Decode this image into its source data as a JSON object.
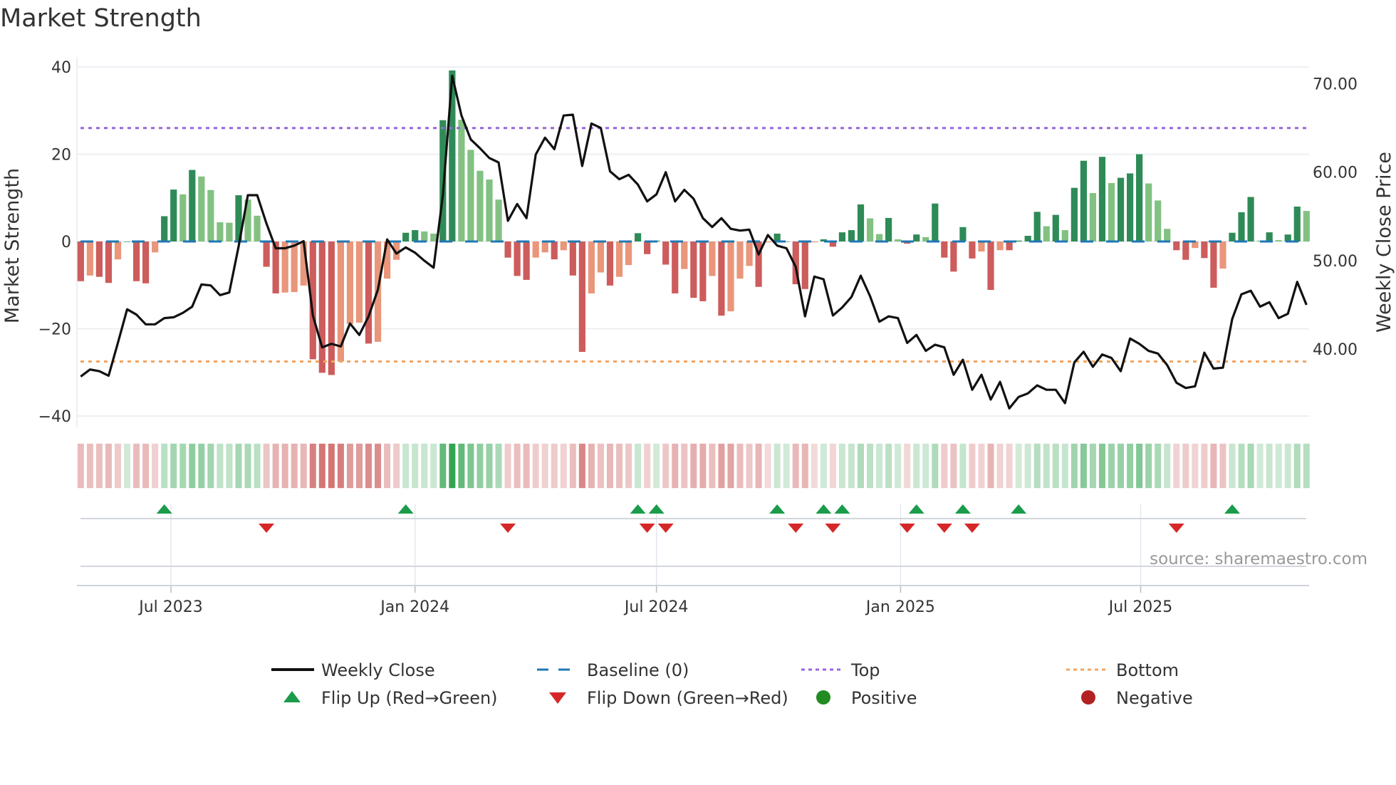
{
  "title": "Market Strength",
  "source": "source: sharemaestro.com",
  "colors": {
    "pos_strong": "#2e8b57",
    "pos_weak": "#82c182",
    "neg_strong": "#cd5c5c",
    "neg_weak": "#e9967a",
    "baseline": "#1f77b4",
    "top": "#9966dd",
    "bottom": "#f4a460",
    "close": "#111111",
    "flip_up": "#1a9c4a",
    "flip_down": "#d62728",
    "positive": "#228b22",
    "negative": "#b22222"
  },
  "chart_data": {
    "type": "bar",
    "title": "Market Strength",
    "ylabel": "Market Strength",
    "y2label": "Weekly Close Price",
    "ylim": [
      -42,
      42
    ],
    "y2lim": [
      32.4,
      71.8
    ],
    "yticks": [
      "40",
      "20",
      "0",
      "−20",
      "−40"
    ],
    "ytick_values": [
      40,
      20,
      0,
      -20,
      -40
    ],
    "y2ticks": [
      "70.00",
      "60.00",
      "50.00",
      "40.00"
    ],
    "y2tick_values": [
      70,
      60,
      50,
      40
    ],
    "xticks": [
      {
        "label": "Jul 2023",
        "date": "2023-07-01"
      },
      {
        "label": "Jan 2024",
        "date": "2024-01-01"
      },
      {
        "label": "Jul 2024",
        "date": "2024-07-01"
      },
      {
        "label": "Jan 2025",
        "date": "2025-01-01"
      },
      {
        "label": "Jul 2025",
        "date": "2025-07-01"
      }
    ],
    "start_date": "2023-04-24",
    "interval_days": 7,
    "levels": {
      "baseline": 0,
      "top": 26,
      "bottom": -27.5
    },
    "strength": [
      -9.1,
      -7.8,
      -8.1,
      -9.5,
      -4.1,
      0,
      -9.1,
      -9.6,
      -2.5,
      5.8,
      11.9,
      10.8,
      16.4,
      14.9,
      11.8,
      4.4,
      4.3,
      10.6,
      9.6,
      5.9,
      -5.8,
      -11.9,
      -11.7,
      -11.6,
      -10.1,
      -27,
      -30.1,
      -30.6,
      -27.5,
      -18.9,
      -18.6,
      -23.4,
      -23,
      -8.5,
      -4.2,
      2,
      2.6,
      2.3,
      1.8,
      27.8,
      39.2,
      27.9,
      21,
      16.2,
      14.2,
      9.6,
      -3.7,
      -7.9,
      -8.8,
      -3.7,
      -2.5,
      -4.1,
      -2,
      -7.8,
      -25.3,
      -11.9,
      -7.1,
      -10.1,
      -8.1,
      -5.4,
      1.9,
      -2.9,
      0.2,
      -5.3,
      -11.9,
      -6.3,
      -12.9,
      -13.7,
      -7.9,
      -17,
      -16,
      -8.5,
      -5.6,
      -10.4,
      -0.2,
      1.8,
      0,
      -9.8,
      -10.9,
      -0.2,
      0.5,
      -1.2,
      2.1,
      2.6,
      8.5,
      5.3,
      1.7,
      5.4,
      0.5,
      -0.5,
      1.6,
      1.0,
      8.7,
      -3.7,
      -6.9,
      3.3,
      -3.9,
      -2.3,
      -11.1,
      -2.0,
      -2.0,
      0.2,
      1.3,
      6.8,
      3.5,
      6.1,
      2.6,
      12.3,
      18.5,
      11.1,
      19.4,
      13.4,
      14.6,
      15.6,
      20.0,
      13.3,
      9.4,
      2.9,
      -2.0,
      -4.2,
      -1.5,
      -3.8,
      -10.6,
      -6.2,
      2.0,
      6.7,
      10.2,
      0.2,
      2.1,
      0.3,
      1.6,
      8.0,
      7.0
    ],
    "weekly_close": [
      36.9,
      37.7,
      37.5,
      37.0,
      40.7,
      44.5,
      43.9,
      42.8,
      42.8,
      43.5,
      43.6,
      44.1,
      44.8,
      47.3,
      47.2,
      46.1,
      46.4,
      51.6,
      57.4,
      57.4,
      54.2,
      51.4,
      51.4,
      51.7,
      52.2,
      43.8,
      40.2,
      40.6,
      40.3,
      42.9,
      41.6,
      43.7,
      46.7,
      52.4,
      50.8,
      51.5,
      50.9,
      50.0,
      49.2,
      57.4,
      70.9,
      66.4,
      63.7,
      62.7,
      61.6,
      61.1,
      54.5,
      56.4,
      54.8,
      62.0,
      63.9,
      62.6,
      66.4,
      66.5,
      60.7,
      65.5,
      65.0,
      60.1,
      59.2,
      59.7,
      58.6,
      56.7,
      57.5,
      60.0,
      56.7,
      58.0,
      57.0,
      54.8,
      53.8,
      54.8,
      53.6,
      53.4,
      53.5,
      50.7,
      52.9,
      51.7,
      51.4,
      49.3,
      43.7,
      48.2,
      47.9,
      43.8,
      44.7,
      45.9,
      48.3,
      46.0,
      43.1,
      43.7,
      43.5,
      40.7,
      41.6,
      39.8,
      40.5,
      40.2,
      37.1,
      38.8,
      35.4,
      37.1,
      34.3,
      36.3,
      33.3,
      34.6,
      35.0,
      35.9,
      35.4,
      35.4,
      33.9,
      38.5,
      39.7,
      38.0,
      39.4,
      39.0,
      37.5,
      41.2,
      40.6,
      39.8,
      39.5,
      38.2,
      36.2,
      35.6,
      35.8,
      39.6,
      37.8,
      37.9,
      43.4,
      46.2,
      46.6,
      44.8,
      45.3,
      43.5,
      44.0,
      47.6,
      45.0
    ],
    "flip_up_weeks": [
      9,
      35,
      60,
      62,
      75,
      80,
      82,
      90,
      95,
      101,
      124
    ],
    "flip_down_weeks": [
      20,
      46,
      61,
      63,
      77,
      81,
      89,
      93,
      96,
      118
    ],
    "legend": {
      "placement": "bottom",
      "items": [
        {
          "label": "Weekly Close",
          "kind": "line"
        },
        {
          "label": "Baseline (0)",
          "kind": "dash"
        },
        {
          "label": "Top",
          "kind": "dot-top"
        },
        {
          "label": "Bottom",
          "kind": "dot-bottom"
        },
        {
          "label": "Flip Up (Red→Green)",
          "kind": "up"
        },
        {
          "label": "Flip Down (Green→Red)",
          "kind": "down"
        },
        {
          "label": "Positive",
          "kind": "pos"
        },
        {
          "label": "Negative",
          "kind": "neg"
        }
      ]
    }
  }
}
